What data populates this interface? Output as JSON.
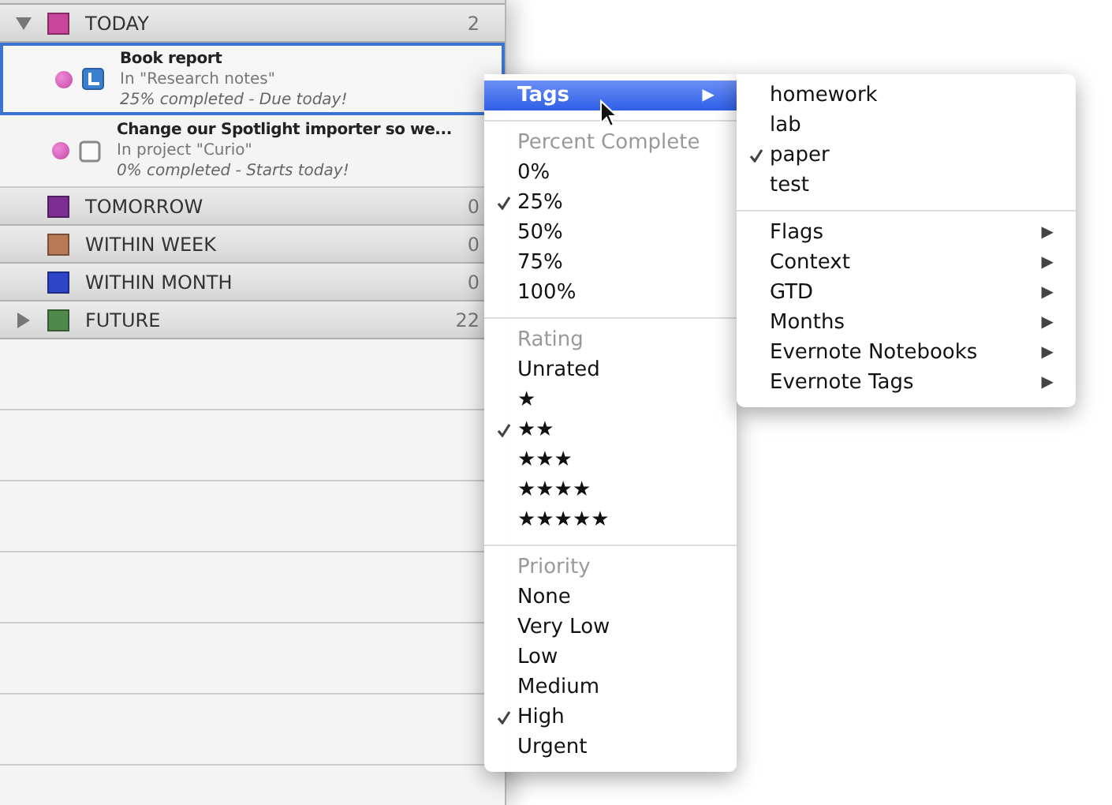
{
  "task_list": {
    "groups": [
      {
        "label": "TODAY",
        "color": "#c8479c",
        "count": "2",
        "expanded": true,
        "tasks": [
          {
            "title": "Book report",
            "location": "In \"Research notes\"",
            "status": "25% completed - Due today!",
            "selected": true,
            "kind": "note"
          },
          {
            "title": "Change our Spotlight importer so we...",
            "location": "In project \"Curio\"",
            "status": "0% completed - Starts today!",
            "selected": false,
            "kind": "checkbox"
          }
        ]
      },
      {
        "label": "TOMORROW",
        "color": "#7b2d92",
        "count": "0"
      },
      {
        "label": "WITHIN WEEK",
        "color": "#b87a55",
        "count": "0"
      },
      {
        "label": "WITHIN MONTH",
        "color": "#2d46c8",
        "count": "0"
      },
      {
        "label": "FUTURE",
        "color": "#4f8a4a",
        "count": "22",
        "expanded": false
      }
    ]
  },
  "context_menu": {
    "top_item": {
      "label": "Tags",
      "selected": true,
      "arrow": "▶"
    },
    "sections": [
      {
        "heading": "Percent Complete",
        "items": [
          {
            "label": "0%",
            "checked": false
          },
          {
            "label": "25%",
            "checked": true
          },
          {
            "label": "50%",
            "checked": false
          },
          {
            "label": "75%",
            "checked": false
          },
          {
            "label": "100%",
            "checked": false
          }
        ]
      },
      {
        "heading": "Rating",
        "items": [
          {
            "label": "Unrated",
            "checked": false
          },
          {
            "label": "★",
            "checked": false
          },
          {
            "label": "★★",
            "checked": true
          },
          {
            "label": "★★★",
            "checked": false
          },
          {
            "label": "★★★★",
            "checked": false
          },
          {
            "label": "★★★★★",
            "checked": false
          }
        ]
      },
      {
        "heading": "Priority",
        "items": [
          {
            "label": "None",
            "checked": false
          },
          {
            "label": "Very Low",
            "checked": false
          },
          {
            "label": "Low",
            "checked": false
          },
          {
            "label": "Medium",
            "checked": false
          },
          {
            "label": "High",
            "checked": true
          },
          {
            "label": "Urgent",
            "checked": false
          }
        ]
      }
    ]
  },
  "tags_submenu": {
    "sections": [
      {
        "kind": "checkable",
        "items": [
          {
            "label": "homework",
            "checked": false
          },
          {
            "label": "lab",
            "checked": false
          },
          {
            "label": "paper",
            "checked": true
          },
          {
            "label": "test",
            "checked": false
          }
        ]
      },
      {
        "kind": "submenus",
        "items": [
          {
            "label": "Flags",
            "arrow": "▶"
          },
          {
            "label": "Context",
            "arrow": "▶"
          },
          {
            "label": "GTD",
            "arrow": "▶"
          },
          {
            "label": "Months",
            "arrow": "▶"
          },
          {
            "label": "Evernote Notebooks",
            "arrow": "▶"
          },
          {
            "label": "Evernote Tags",
            "arrow": "▶"
          }
        ]
      }
    ]
  }
}
